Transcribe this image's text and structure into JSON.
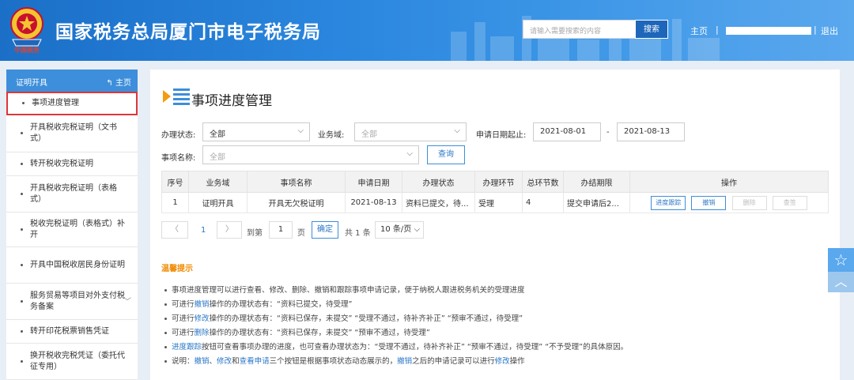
{
  "header": {
    "emblem_text": "中国税务",
    "title": "国家税务总局厦门市电子税务局",
    "search_placeholder": "请输入需要搜索的内容",
    "search_button": "搜索",
    "home": "主页",
    "separator": "|",
    "logout": "退出"
  },
  "sidebar": {
    "header": "证明开具",
    "home_link": "主页",
    "items": [
      {
        "label": "事项进度管理"
      },
      {
        "label": "开具税收完税证明（文书式）"
      },
      {
        "label": "转开税收完税证明"
      },
      {
        "label": "开具税收完税证明（表格式）"
      },
      {
        "label": "税收完税证明（表格式）补开"
      },
      {
        "label": "开具中国税收居民身份证明"
      },
      {
        "label": "服务贸易等项目对外支付税务备案"
      },
      {
        "label": "转开印花税票销售凭证"
      },
      {
        "label": "换开税收完税凭证（委托代征专用）"
      }
    ]
  },
  "main": {
    "title": "事项进度管理",
    "filters": {
      "status_label": "办理状态:",
      "status_value": "全部",
      "domain_label": "业务域:",
      "domain_value": "全部",
      "date_label": "申请日期起止:",
      "date_from": "2021-08-01",
      "date_sep": "-",
      "date_to": "2021-08-13",
      "name_label": "事项名称:",
      "name_value": "全部",
      "query_button": "查询"
    },
    "table": {
      "headers": [
        "序号",
        "业务域",
        "事项名称",
        "申请日期",
        "办理状态",
        "办理环节",
        "总环节数",
        "办结期限",
        "操作"
      ],
      "rows": [
        {
          "no": "1",
          "domain": "证明开具",
          "name": "开具无欠税证明",
          "date": "2021-08-13",
          "status": "资料已提交，待...",
          "stage": "受理",
          "total": "4",
          "deadline": "提交申请后2...",
          "actions": [
            "进度跟踪",
            "撤销",
            "删除",
            "查签"
          ]
        }
      ]
    },
    "pager": {
      "prev": "〈",
      "current": "1",
      "next": "〉",
      "goto_label": "到第",
      "goto_value": "1",
      "page_unit": "页",
      "confirm": "确定",
      "total": "共 1 条",
      "page_size": "10 条/页"
    },
    "tips": {
      "title": "温馨提示",
      "lines": [
        [
          "事项进度管理可以进行查看、修改、删除、撤销和跟踪事项申请记录，便于纳税人跟进税务机关的受理进度"
        ],
        [
          "可进行",
          "撤销",
          "操作的办理状态有：“资料已提交，待受理”"
        ],
        [
          "可进行",
          "修改",
          "操作的办理状态有：“资料已保存，未提交” “受理不通过，待补齐补正” “预审不通过，待受理”"
        ],
        [
          "可进行",
          "删除",
          "操作的办理状态有：“资料已保存，未提交” “预审不通过，待受理”"
        ],
        [
          "",
          "进度跟踪",
          "按钮可查看事项办理的进度，也可查看办理状态为：“受理不通过，待补齐补正” “预审不通过，待受理” “不予受理”的具体原因。"
        ],
        [
          "说明：",
          "撤销",
          "、",
          "修改",
          "和",
          "查看申请",
          "三个按钮是根据事项状态动态展示的，",
          "撤销",
          "之后的申请记录可以进行",
          "修改",
          "操作"
        ]
      ]
    }
  },
  "colors": {
    "header_blue": "#2a86de",
    "sidebar_head": "#3d8edb",
    "active_border": "#e0353a",
    "tip_title": "#f08a00",
    "link_blue": "#2a77c7"
  }
}
